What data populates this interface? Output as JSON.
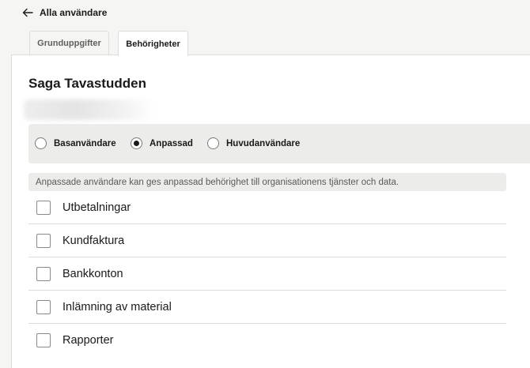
{
  "nav": {
    "back_label": "Alla användare"
  },
  "tabs": [
    {
      "label": "Grunduppgifter",
      "active": false
    },
    {
      "label": "Behörigheter",
      "active": true
    }
  ],
  "user": {
    "name": "Saga Tavastudden"
  },
  "roles": {
    "selected": "Anpassad",
    "options": [
      {
        "label": "Basanvändare",
        "checked": false
      },
      {
        "label": "Anpassad",
        "checked": true
      },
      {
        "label": "Huvudanvändare",
        "checked": false
      }
    ]
  },
  "info_text": "Anpassade användare kan ges anpassad behörighet till organisationens tjänster och data.",
  "permissions": [
    {
      "label": "Utbetalningar",
      "checked": false
    },
    {
      "label": "Kundfaktura",
      "checked": false
    },
    {
      "label": "Bankkonton",
      "checked": false
    },
    {
      "label": "Inlämning av material",
      "checked": false
    },
    {
      "label": "Rapporter",
      "checked": false
    }
  ],
  "colors": {
    "panel": "#ffffff",
    "background": "#f5f5f3",
    "role_box": "#ececea",
    "text": "#1a1a1a"
  }
}
